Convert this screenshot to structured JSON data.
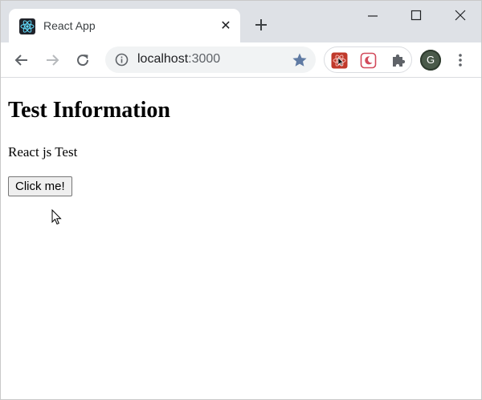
{
  "browser": {
    "tab": {
      "title": "React App",
      "close_glyph": "✕",
      "favicon": "react-logo-icon"
    },
    "new_tab_icon": "plus-icon",
    "window_controls": [
      "minimize-icon",
      "maximize-icon",
      "close-icon"
    ],
    "toolbar": {
      "back_icon": "arrow-left-icon",
      "forward_icon": "arrow-right-icon",
      "reload_icon": "reload-icon"
    },
    "omnibox": {
      "info_icon": "info-icon",
      "url_host": "localhost",
      "url_port": ":3000",
      "bookmark_icon": "star-icon"
    },
    "extensions": [
      "react-devtools-icon",
      "dark-mode-icon",
      "puzzle-icon"
    ],
    "profile_initial": "G",
    "menu_icon": "kebab-menu-icon"
  },
  "page": {
    "heading": "Test Information",
    "subtitle": "React js Test",
    "button_label": "Click me!"
  },
  "colors": {
    "tabstrip_bg": "#dee1e6",
    "omnibox_bg": "#f1f3f4",
    "star_blue": "#5f7aa3",
    "react_cyan": "#61dafb",
    "ext_red": "#c0392b"
  }
}
